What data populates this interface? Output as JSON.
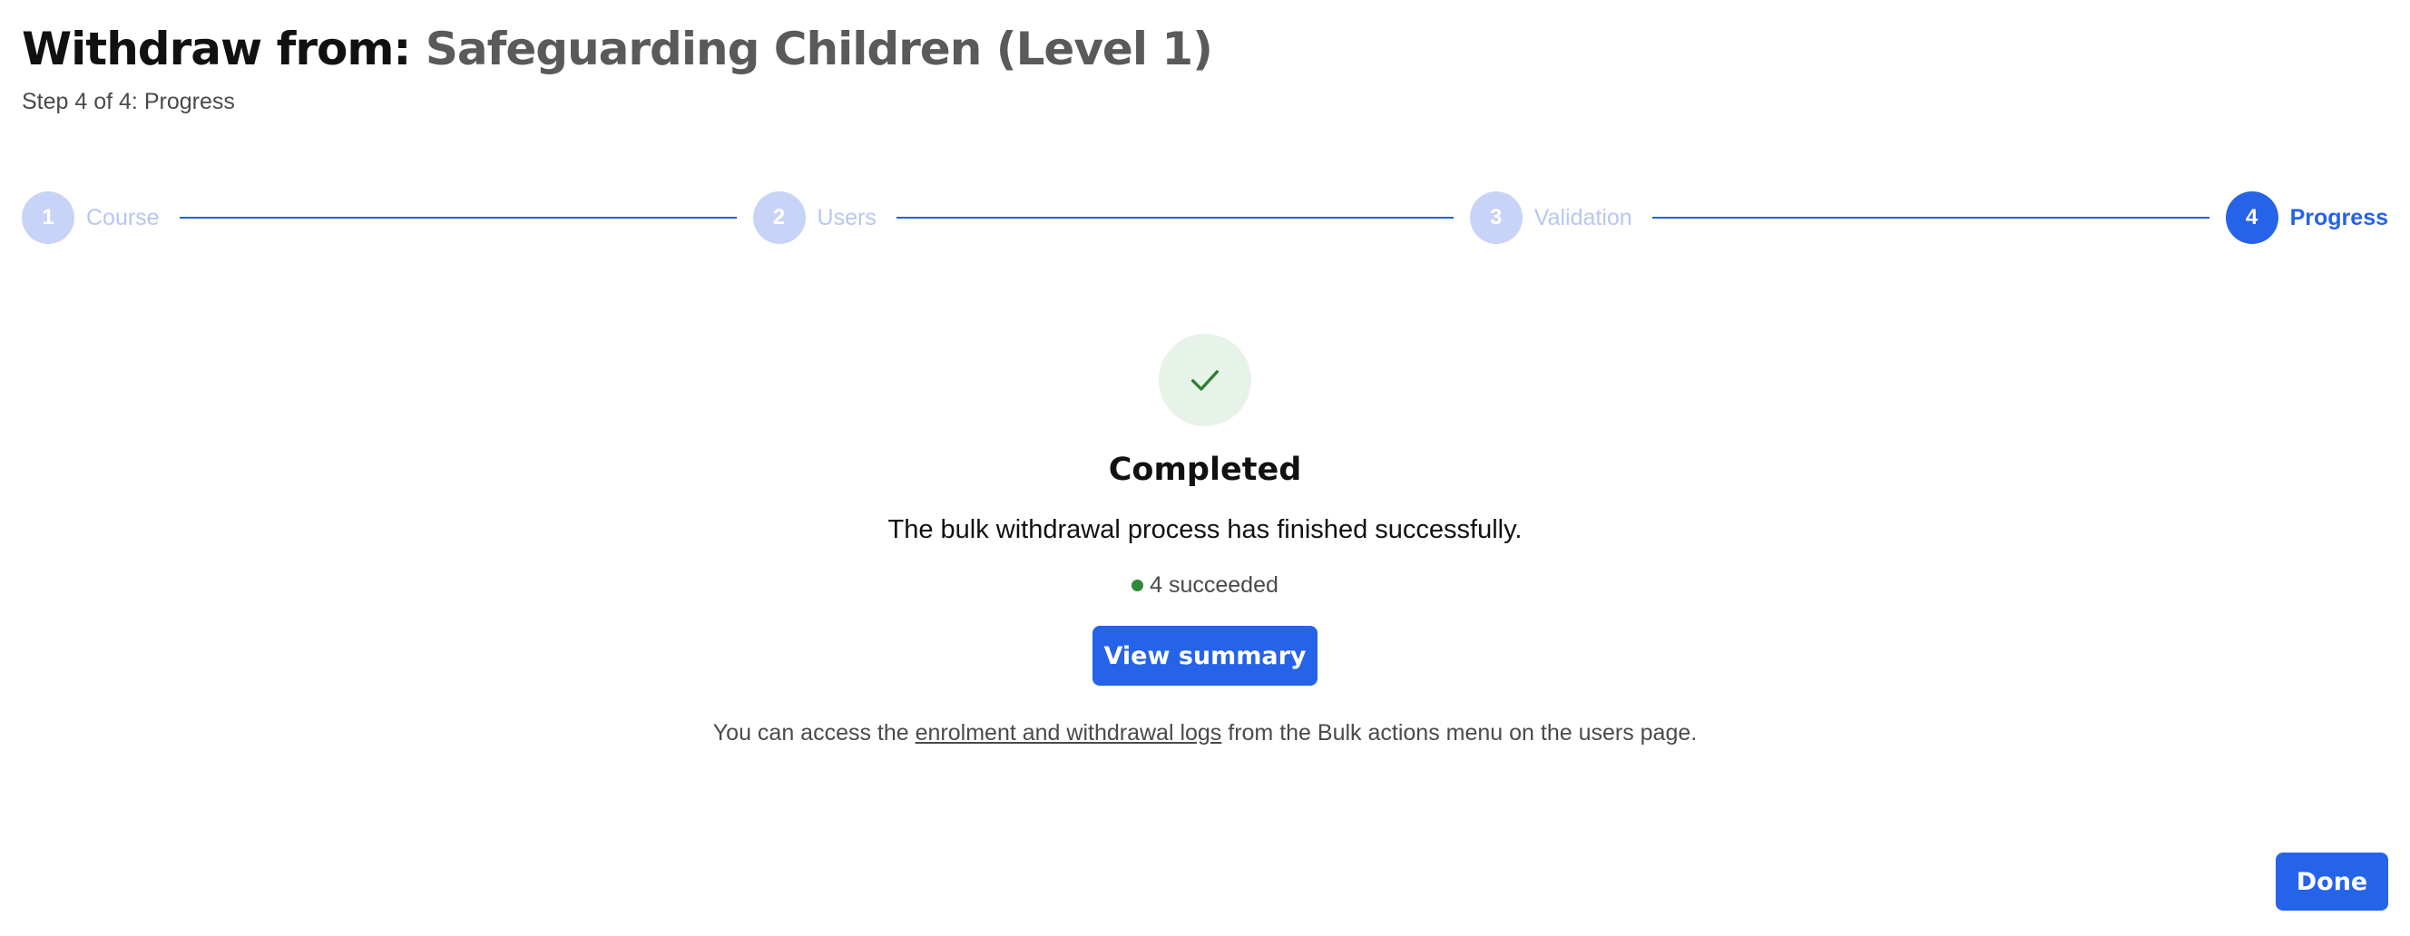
{
  "header": {
    "title_prefix": "Withdraw from:",
    "course_name": "Safeguarding Children (Level 1)",
    "subtitle": "Step 4 of 4: Progress"
  },
  "stepper": {
    "steps": [
      {
        "number": "1",
        "label": "Course"
      },
      {
        "number": "2",
        "label": "Users"
      },
      {
        "number": "3",
        "label": "Validation"
      },
      {
        "number": "4",
        "label": "Progress"
      }
    ],
    "active_step": 4
  },
  "result": {
    "icon": "checkmark-icon",
    "heading": "Completed",
    "message": "The bulk withdrawal process has finished successfully.",
    "succeeded_text": "4 succeeded",
    "view_summary_label": "View summary",
    "note_before": "You can access the ",
    "note_link": "enrolment and withdrawal logs",
    "note_after": " from the Bulk actions menu on the users page."
  },
  "footer": {
    "done_label": "Done"
  },
  "colors": {
    "primary": "#2563e8",
    "inactive_step": "#c7d4f7",
    "success": "#2e8a35",
    "success_bg": "#e7f2e8"
  }
}
